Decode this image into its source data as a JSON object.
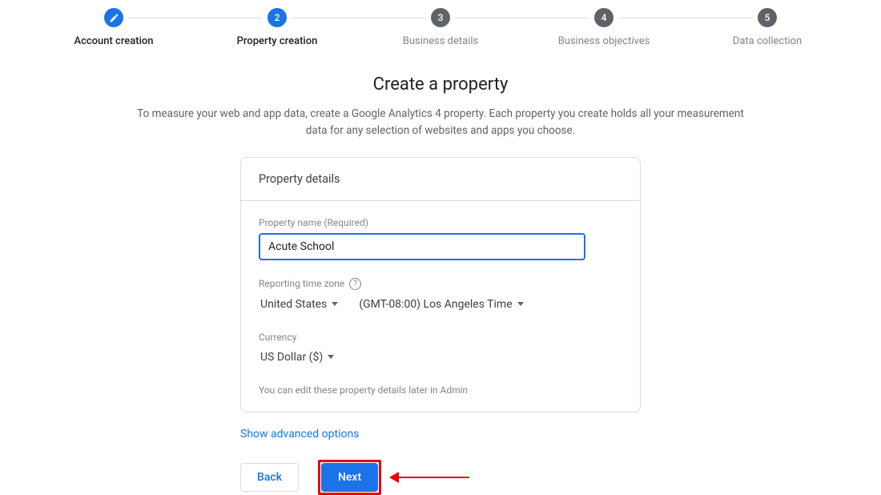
{
  "stepper": {
    "steps": [
      {
        "label": "Account creation",
        "state": "done"
      },
      {
        "label": "Property creation",
        "state": "active",
        "num": "2"
      },
      {
        "label": "Business details",
        "state": "todo",
        "num": "3"
      },
      {
        "label": "Business objectives",
        "state": "todo",
        "num": "4"
      },
      {
        "label": "Data collection",
        "state": "todo",
        "num": "5"
      }
    ]
  },
  "heading": {
    "title": "Create a property",
    "subtitle": "To measure your web and app data, create a Google Analytics 4 property. Each property you create holds all your measurement data for any selection of websites and apps you choose."
  },
  "card": {
    "section_title": "Property details",
    "name_label": "Property name (Required)",
    "name_value": "Acute School",
    "tz_label": "Reporting time zone",
    "tz_country": "United States",
    "tz_offset": "(GMT-08:00) Los Angeles Time",
    "currency_label": "Currency",
    "currency_value": "US Dollar ($)",
    "hint": "You can edit these property details later in Admin"
  },
  "advanced": {
    "label": "Show advanced options"
  },
  "buttons": {
    "back": "Back",
    "next": "Next"
  },
  "icons": {
    "help": "?"
  }
}
